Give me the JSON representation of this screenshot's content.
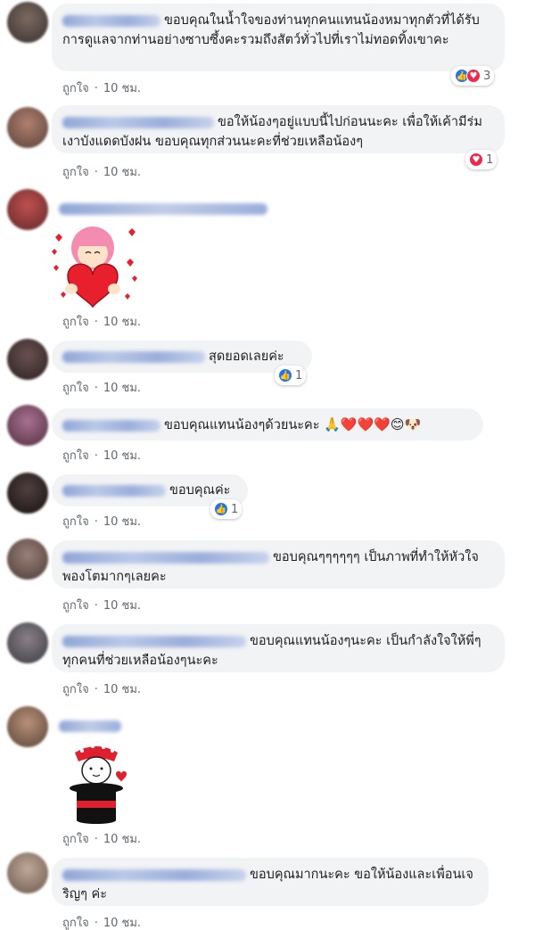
{
  "labels": {
    "like": "ถูกใจ",
    "time": "10 ชม."
  },
  "comments": [
    {
      "text": "ขอบคุณในน้ำใจของท่านทุกคนแทนน้องหมาทุกตัวที่ได้รับการดูแลจากท่านอย่างซาบซึ้งคะรวมถึงสัตว์ทั่วไปที่เราไม่ทอดทิ้งเขาคะ",
      "reactions": [
        "like",
        "love"
      ],
      "count": "3"
    },
    {
      "text": "ขอให้น้องๆอยู่แบบนี้ไปก่อนนะคะ เพื่อให้เค้ามีร่มเงาบังแดดบังฝน ขอบคุณทุกส่วนนะคะที่ช่วยเหลือน้องๆ",
      "reactions": [
        "love"
      ],
      "count": "1"
    },
    {
      "sticker": "heart-girl-sticker"
    },
    {
      "text": "สุดยอดเลยค่ะ",
      "reactions": [
        "like"
      ],
      "count": "1"
    },
    {
      "text": "ขอบคุณแทนน้องๆด้วยนะคะ",
      "emojis": "🙏❤️❤️❤️😊🐶"
    },
    {
      "text": "ขอบคุณค่ะ",
      "reactions": [
        "like"
      ],
      "count": "1"
    },
    {
      "text": "ขอบคุณๆๆๆๆๆๆ เป็นภาพที่ทำให้หัวใจพองโตมากๆเลยคะ"
    },
    {
      "text": "ขอบคุณแทนน้องๆนะคะ เป็นกำลังใจให้พี่ๆทุกคนที่ช่วยเหลือน้องๆนะคะ"
    },
    {
      "sticker": "magician-hat-sticker"
    },
    {
      "text": "ขอบคุณมากนะคะ ขอให้น้องและเพื่อนเจริญๆ ค่ะ"
    }
  ]
}
